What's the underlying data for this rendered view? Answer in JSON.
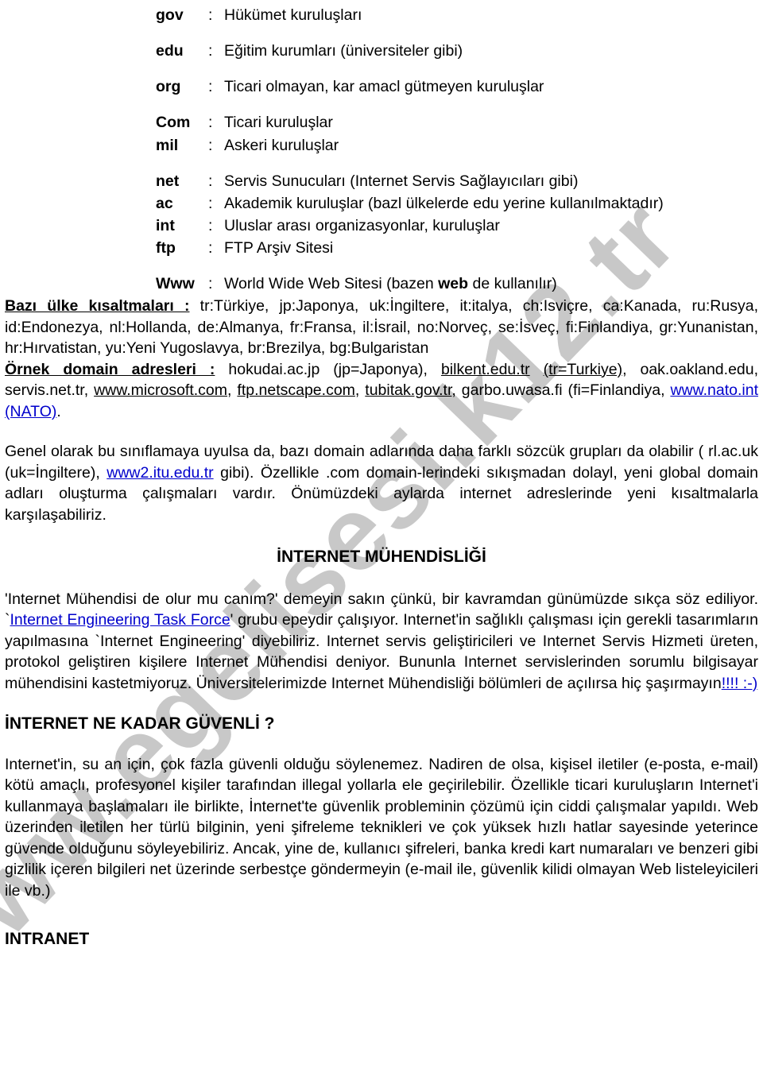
{
  "watermark": {
    "text": "www.egelisesi.k12.tr",
    "color": "#c8c8c8"
  },
  "colors": {
    "link": "#0000cc",
    "text": "#000000",
    "background": "#ffffff"
  },
  "domain_list": {
    "separator": ":",
    "entries": [
      {
        "term": "gov",
        "desc": "Hükümet kuruluşları"
      },
      {
        "term": "edu",
        "desc": "Eğitim kurumları (üniversiteler gibi)"
      },
      {
        "term": "org",
        "desc": "Ticari olmayan, kar amacl gütmeyen kuruluşlar"
      },
      {
        "term": "Com",
        "desc": "Ticari kuruluşlar"
      },
      {
        "term": "mil",
        "desc": "Askeri kuruluşlar"
      },
      {
        "term": "net",
        "desc": "Servis Sunucuları (Internet Servis Sağlayıcıları gibi)"
      },
      {
        "term": "ac",
        "desc": "Akademik kuruluşlar (bazl ülkelerde edu yerine kullanılmaktadır)"
      },
      {
        "term": "int",
        "desc": "Uluslar arası organizasyonlar, kuruluşlar"
      },
      {
        "term": "ftp",
        "desc": "FTP Arşiv Sitesi"
      },
      {
        "term": "Www",
        "desc_pre": "World Wide Web Sitesi (bazen ",
        "desc_bold": "web",
        "desc_post": " de kullanılır)"
      }
    ]
  },
  "country_abbreviations": {
    "label": "Bazı ülke kısaltmaları :",
    "body": "tr:Türkiye, jp:Japonya, uk:İngiltere, it:italya, ch:Isviçre, ca:Kanada, ru:Rusya, id:Endonezya, nl:Hollanda, de:Almanya, fr:Fransa, il:İsrail, no:Norveç, se:İsveç, fi:Finlandiya, gr:Yunanistan, hr:Hırvatistan, yu:Yeni Yugoslavya, br:Brezilya, bg:Bulgaristan"
  },
  "example_domains": {
    "label": "Örnek domain adresleri :",
    "parts": {
      "p1": "hokudai.ac.jp (jp=Japonya), ",
      "u1": "bilkent.edu.tr",
      "p2": " ",
      "u2": "(tr=Turkiye)",
      "p3": ", oak.oakland.edu, servis.net.tr, ",
      "u3": "www.microsoft.com",
      "p4": ", ",
      "u4": "ftp.netscape.com",
      "p5": ", ",
      "u5": "tubitak.gov.tr",
      "p6": ", garbo.uwasa.fi (fi=Finlandiya, ",
      "link1": "www.nato.int (NATO)",
      "p7": "."
    }
  },
  "paragraph_classification": {
    "p1": "Genel olarak bu sınıflamaya uyulsa da, bazı domain adlarında daha farklı sözcük grupları da olabilir ( rl.ac.uk (uk=İngiltere), ",
    "link": "www2.itu.edu.tr",
    "p2": " gibi). Özellikle .com domain-lerindeki sıkışmadan dolayl, yeni global domain adları oluşturma çalışmaları vardır. Önümüzdeki aylarda internet adreslerinde yeni kısaltmalarla karşılaşabiliriz."
  },
  "section_engineering": {
    "title": "İNTERNET MÜHENDİSLİĞİ",
    "p1": "'Internet Mühendisi de olur mu canım?' demeyin sakın çünkü, bir kavramdan günümüzde sıkça söz ediliyor. `",
    "link": "Internet Engineering Task Force",
    "p2": "' grubu epeydir çalışıyor. Internet'in sağlıklı çalışması için gerekli tasarımların yapılmasına `Internet Engineering' diyebiliriz. Internet servis geliştiricileri ve Internet Servis Hizmeti üreten, protokol geliştiren kişilere Internet Mühendisi deniyor. Bununla Internet servislerinden sorumlu bilgisayar mühendisini kastetmiyoruz. Üniversitelerimizde Internet Mühendisliği bölümleri de açılırsa hiç şaşırmayın",
    "link2": "!!!! :-)"
  },
  "section_security": {
    "title": "İNTERNET NE KADAR GÜVENLİ ?",
    "p1": "Internet'in, su an için, çok fazla güvenli olduğu söylenemez. Nadiren de olsa, kişisel iletiler (e-posta, e-mail) kötü amaçlı, profesyonel kişiler tarafından illegal yollarla ele geçirilebilir. Özellikle ticari kuruluşların Internet'i kullanmaya başlamaları ile birlikte, İnternet'te güvenlik probleminin çözümü için ciddi çalışmalar yapıldı. Web üzerinden iletilen her türlü bilginin, yeni şifreleme teknikleri ve çok yüksek hızlı hatlar sayesinde yeterince güvende olduğunu söyleyebiliriz. Ancak, yine de, kullanıcı şifreleri, banka kredi kart numaraları ve benzeri gibi gizlilik içeren bilgileri net üzerinde serbestçe göndermeyin (e-mail ile, güvenlik kilidi olmayan Web listeleyicileri ile vb.)"
  },
  "section_intranet": {
    "title": "INTRANET"
  }
}
